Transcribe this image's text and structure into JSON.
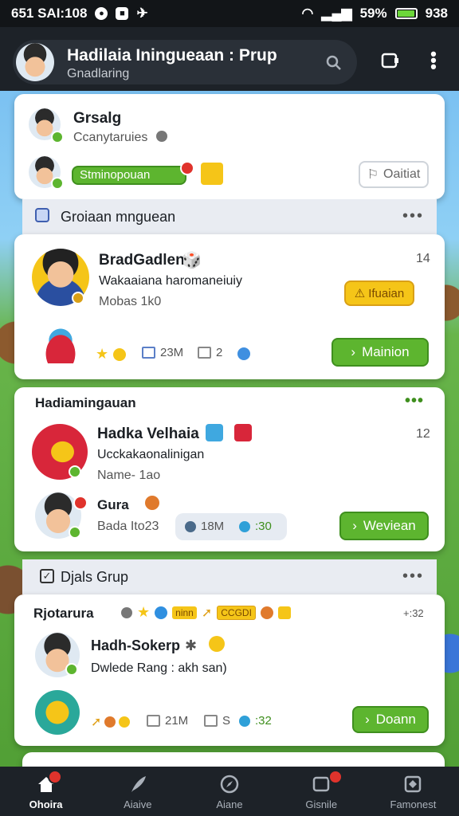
{
  "status_bar": {
    "left_text": "651 SAI:108",
    "battery": "59%",
    "time": "938"
  },
  "header": {
    "title": "Hadilaia Iningueaan : Prup",
    "subtitle": "Gnadlaring"
  },
  "top_card": {
    "name": "Grsalg",
    "subtext": "Ccanytaruies",
    "progress_label": "Stminopouan",
    "button": "Oaitiat"
  },
  "sections": [
    {
      "title": "Groiaan mnguean"
    },
    {
      "title": "Djals Grup"
    }
  ],
  "card1": {
    "name": "BradGadlen",
    "line1": "Wakaaiana haromaneiuiy",
    "line2": "Mobas 1k0",
    "time": "14",
    "yellow_btn": "Ifuaian",
    "stat1": "23M",
    "stat2": "2",
    "green_btn": "Mainion"
  },
  "card2": {
    "header": "Hadiamingauan",
    "name": "Hadka Velhaia",
    "line1": "Ucckakaonalinigan",
    "line2": "Name- 1ao",
    "time": "12",
    "person": "Gura",
    "person_sub": "Bada Ito23",
    "stat1": "18M",
    "stat2": ":30",
    "green_btn": "Weviean"
  },
  "card3": {
    "header": "Rjotarura",
    "tag1": "ninn",
    "tag2": "CCGDI",
    "corner": "+:32",
    "name": "Hadh-Sokerp",
    "line1": "Dwlede Rang : akh san)",
    "stat1": "21M",
    "stat2": "S",
    "stat3": ":32",
    "green_btn": "Doann"
  },
  "nav": [
    {
      "label": "Ohoira"
    },
    {
      "label": "Aiaive"
    },
    {
      "label": "Aiane"
    },
    {
      "label": "Gisnile"
    },
    {
      "label": "Famonest"
    }
  ],
  "colors": {
    "accent_green": "#5db52f",
    "header_bg": "#1d2228",
    "yellow": "#f5c518"
  }
}
